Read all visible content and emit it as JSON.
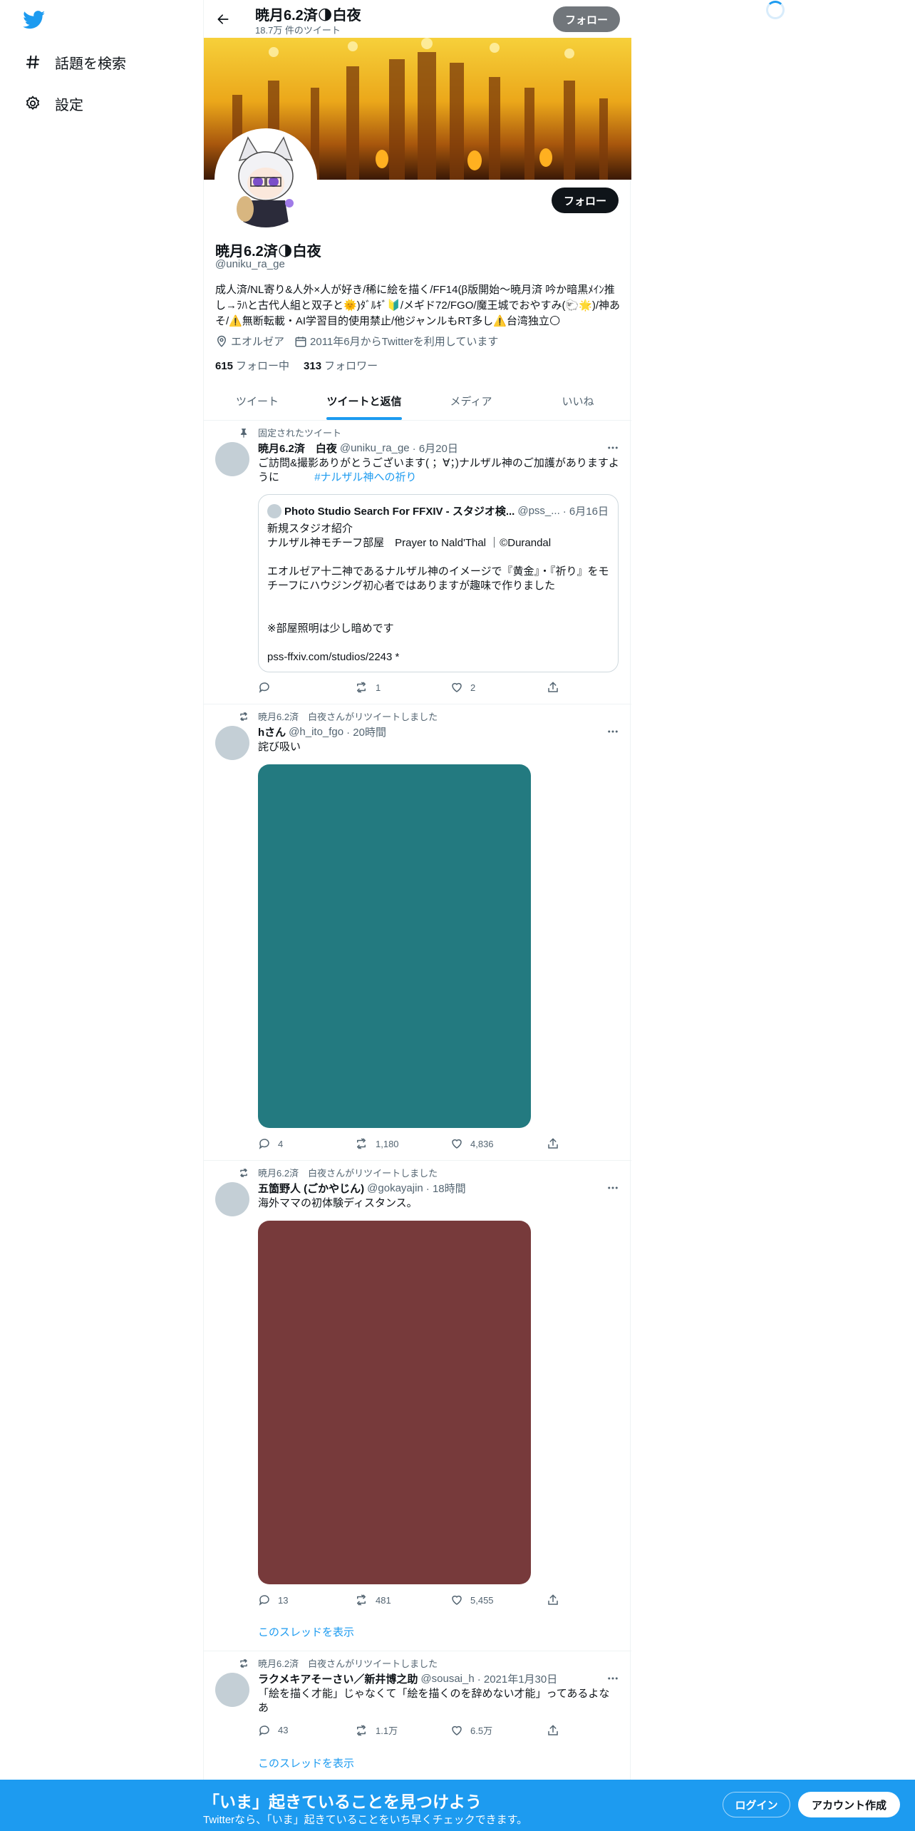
{
  "sidebar": {
    "items": [
      {
        "label": "話題を検索",
        "icon": "hashtag-icon"
      },
      {
        "label": "設定",
        "icon": "gear-icon"
      }
    ]
  },
  "header": {
    "name": "暁月6.2済🌗白夜",
    "tweet_count": "18.7万 件のツイート",
    "follow_label": "フォロー"
  },
  "profile": {
    "name": "暁月6.2済🌗白夜",
    "handle": "@uniku_ra_ge",
    "follow_label": "フォロー",
    "bio": "成人済/NL寄り&人外×人が好き/稀に絵を描く/FF14(β版開始～暁月済 吟か暗黒ﾒｲﾝ推し→ﾗﾊと古代人組と双子と🌞)ﾀﾞﾙｷﾞ🔰/メギド72/FGO/魔王城でおやすみ(🐑🌟)/神あそ/⚠️無断転載・AI学習目的使用禁止/他ジャンルもRT多し⚠️台湾独立🌕",
    "location": "エオルゼア",
    "joined": "2011年6月からTwitterを利用しています",
    "following_count": "615",
    "following_label": "フォロー中",
    "followers_count": "313",
    "followers_label": "フォロワー"
  },
  "tabs": [
    {
      "label": "ツイート",
      "active": false
    },
    {
      "label": "ツイートと返信",
      "active": true
    },
    {
      "label": "メディア",
      "active": false
    },
    {
      "label": "いいね",
      "active": false
    }
  ],
  "tweets": [
    {
      "context": "固定されたツイート",
      "name": "暁月6.2済　白夜",
      "handle": "@uniku_ra_ge",
      "date": "· 6月20日",
      "text": "ご訪問&撮影ありがとうございます( ；∀；)ナルザル神のご加護がありますように",
      "hashtag": "#ナルザル神への祈り",
      "quote": {
        "name": "Photo Studio Search For FFXIV - スタジオ検...",
        "handle": "@pss_...",
        "date": "· 6月16日",
        "text": "新規スタジオ紹介\nナルザル神モチーフ部屋　Prayer to Nald'Thal ｜©Durandal\n\nエオルゼア十二神であるナルザル神のイメージで『黄金』・『祈り』をモチーフにハウジング初心者ではありますが趣味で作りました\n\n\n※部屋照明は少し暗めです\n\npss-ffxiv.com/studios/2243 *"
      },
      "replies": "",
      "retweets": "1",
      "likes": "2"
    },
    {
      "context": "暁月6.2済　白夜さんがリツイートしました",
      "name": "hさん",
      "handle": "@h_ito_fgo",
      "date": "· 20時間",
      "text": "詫び吸い",
      "media_color": "#237a80",
      "replies": "4",
      "retweets": "1,180",
      "likes": "4,836"
    },
    {
      "context": "暁月6.2済　白夜さんがリツイートしました",
      "name": "五箇野人 (ごかやじん)",
      "handle": "@gokayajin",
      "date": "· 18時間",
      "text": "海外ママの初体験ディスタンス。",
      "media_color": "#773a3b",
      "replies": "13",
      "retweets": "481",
      "likes": "5,455",
      "thread_label": "このスレッドを表示"
    },
    {
      "context": "暁月6.2済　白夜さんがリツイートしました",
      "name": "ラクメキアそーさい／新井博之助",
      "handle": "@sousai_h",
      "date": "· 2021年1月30日",
      "text": "「絵を描く才能」じゃなくて「絵を描くのを辞めない才能」ってあるよなあ",
      "replies": "43",
      "retweets": "1.1万",
      "likes": "6.5万",
      "thread_label": "このスレッドを表示"
    }
  ],
  "bottom_bar": {
    "title": "「いま」起きていることを見つけよう",
    "subtitle": "Twitterなら、「いま」起きていることをいち早くチェックできます。",
    "login_label": "ログイン",
    "signup_label": "アカウント作成"
  },
  "colors": {
    "accent": "#1d9bf0",
    "text": "#0f1419",
    "secondary": "#536471"
  }
}
